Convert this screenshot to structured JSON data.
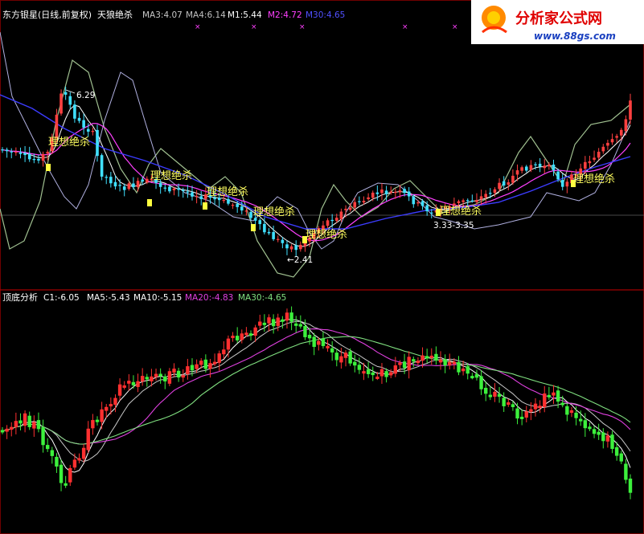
{
  "header_top": {
    "stock": "东方银星(日线,前复权)",
    "indicator": "天狼绝杀",
    "ma3": "MA3:4.07",
    "ma4": "MA4:6.14",
    "m1": "M1:5.44",
    "m2": "M2:4.72",
    "m30": "M30:4.65"
  },
  "header_bottom": {
    "title": "顶底分析",
    "c1": "C1:-6.05",
    "ma5": "MA5:-5.43",
    "ma10": "MA10:-5.15",
    "ma20": "MA20:-4.83",
    "ma30": "MA30:-4.65"
  },
  "annotations": {
    "high": "6.29",
    "low": "←2.41",
    "range": "3.33-3.35",
    "signal": "理想绝杀"
  },
  "watermark": {
    "title": "分析家公式网",
    "url": "www.88gs.com"
  },
  "colors": {
    "up": "#ff3030",
    "down": "#3cf03c",
    "up_top": "#ff4040",
    "down_top": "#40e0ff",
    "ma3": "#c8c8c8",
    "ma4": "#c0c0c0",
    "m1": "#ffffff",
    "m2": "#ff40ff",
    "m30": "#3c3cff",
    "band": "#a0c090",
    "ma5": "#ffffff",
    "ma10": "#c8c8c8",
    "ma20": "#e040e0",
    "ma30": "#80e080",
    "signal": "#ffff40",
    "header_text": "#ffffff",
    "divider": "#a00000"
  },
  "chart_data": [
    {
      "type": "candlestick",
      "title": "东方银星(日线,前复权) 天狼绝杀",
      "series": [
        {
          "name": "MA3",
          "value": 4.07
        },
        {
          "name": "MA4",
          "value": 6.14
        },
        {
          "name": "M1",
          "value": 5.44
        },
        {
          "name": "M2",
          "value": 4.72
        },
        {
          "name": "M30",
          "value": 4.65
        }
      ],
      "price_high": 6.29,
      "price_low": 2.41,
      "signals": [
        {
          "bar": 8
        },
        {
          "bar": 26
        },
        {
          "bar": 34
        },
        {
          "bar": 42
        },
        {
          "bar": 52
        },
        {
          "bar": 73
        },
        {
          "bar": 95
        }
      ]
    },
    {
      "type": "candlestick",
      "title": "顶底分析",
      "series": [
        {
          "name": "C1",
          "value": -6.05
        },
        {
          "name": "MA5",
          "value": -5.43
        },
        {
          "name": "MA10",
          "value": -5.15
        },
        {
          "name": "MA20",
          "value": -4.83
        },
        {
          "name": "MA30",
          "value": -4.65
        }
      ]
    }
  ]
}
